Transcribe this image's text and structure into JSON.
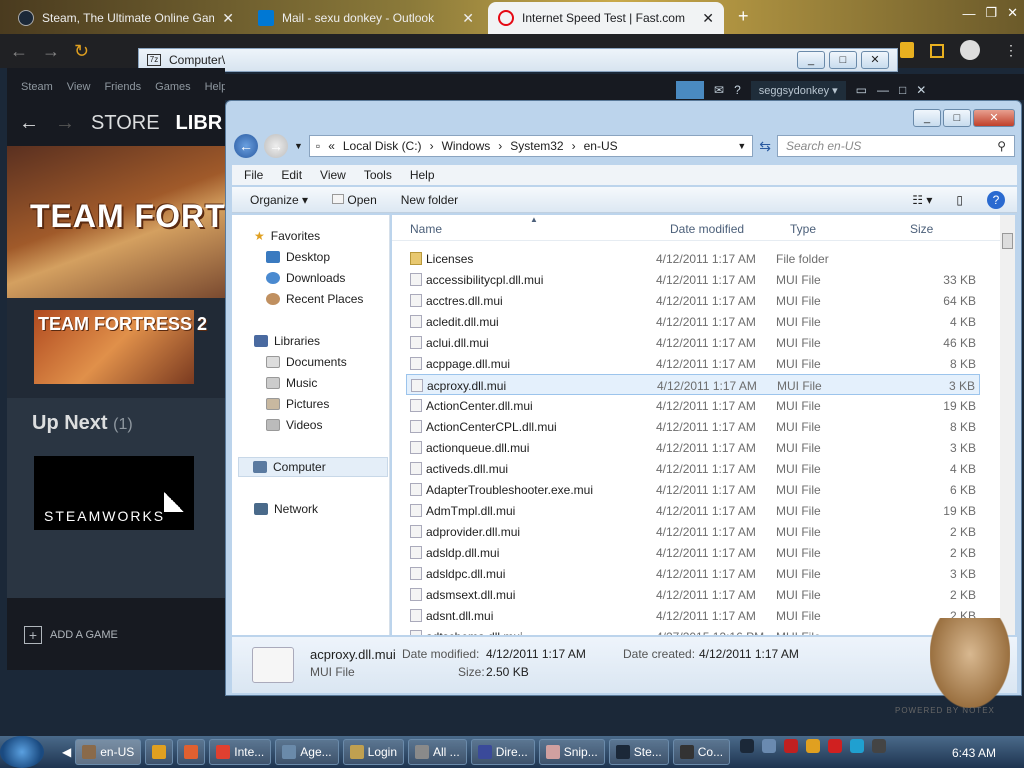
{
  "browser": {
    "tabs": [
      {
        "label": "Steam, The Ultimate Online Gam",
        "color": "#1b2838"
      },
      {
        "label": "Mail - sexu donkey - Outlook",
        "color": "#0078d4"
      },
      {
        "label": "Internet Speed Test | Fast.com",
        "color": "#e50914"
      }
    ],
    "new_tab": "+",
    "close_glyph": "✕"
  },
  "steam": {
    "menu": [
      "Steam",
      "View",
      "Friends",
      "Games",
      "Help"
    ],
    "nav": {
      "back": "←",
      "forward": "→",
      "store": "STORE",
      "library": "LIBR"
    },
    "banner_title": "TEAM FORTRESS",
    "tf2_title": "TEAM FORTRESS 2",
    "upnext": {
      "label": "Up Next",
      "count": "(1)"
    },
    "steamworks": "STEAMWORKS",
    "add_game": "ADD A GAME",
    "username": "seggsydonkey",
    "help": "?"
  },
  "explorer": {
    "outer_title": "Computer\\",
    "breadcrumb": [
      "Local Disk (C:)",
      "Windows",
      "System32",
      "en-US"
    ],
    "search_placeholder": "Search en-US",
    "menu": [
      "File",
      "Edit",
      "View",
      "Tools",
      "Help"
    ],
    "toolbar": {
      "organize": "Organize",
      "open": "Open",
      "new_folder": "New folder"
    },
    "nav": {
      "favorites": "Favorites",
      "desktop": "Desktop",
      "downloads": "Downloads",
      "recent": "Recent Places",
      "libraries": "Libraries",
      "documents": "Documents",
      "music": "Music",
      "pictures": "Pictures",
      "videos": "Videos",
      "computer": "Computer",
      "network": "Network"
    },
    "columns": {
      "name": "Name",
      "date": "Date modified",
      "type": "Type",
      "size": "Size"
    },
    "files": [
      {
        "name": "Licenses",
        "date": "4/12/2011 1:17 AM",
        "type": "File folder",
        "size": "",
        "folder": true
      },
      {
        "name": "accessibilitycpl.dll.mui",
        "date": "4/12/2011 1:17 AM",
        "type": "MUI File",
        "size": "33 KB"
      },
      {
        "name": "acctres.dll.mui",
        "date": "4/12/2011 1:17 AM",
        "type": "MUI File",
        "size": "64 KB"
      },
      {
        "name": "acledit.dll.mui",
        "date": "4/12/2011 1:17 AM",
        "type": "MUI File",
        "size": "4 KB"
      },
      {
        "name": "aclui.dll.mui",
        "date": "4/12/2011 1:17 AM",
        "type": "MUI File",
        "size": "46 KB"
      },
      {
        "name": "acppage.dll.mui",
        "date": "4/12/2011 1:17 AM",
        "type": "MUI File",
        "size": "8 KB"
      },
      {
        "name": "acproxy.dll.mui",
        "date": "4/12/2011 1:17 AM",
        "type": "MUI File",
        "size": "3 KB",
        "selected": true
      },
      {
        "name": "ActionCenter.dll.mui",
        "date": "4/12/2011 1:17 AM",
        "type": "MUI File",
        "size": "19 KB"
      },
      {
        "name": "ActionCenterCPL.dll.mui",
        "date": "4/12/2011 1:17 AM",
        "type": "MUI File",
        "size": "8 KB"
      },
      {
        "name": "actionqueue.dll.mui",
        "date": "4/12/2011 1:17 AM",
        "type": "MUI File",
        "size": "3 KB"
      },
      {
        "name": "activeds.dll.mui",
        "date": "4/12/2011 1:17 AM",
        "type": "MUI File",
        "size": "4 KB"
      },
      {
        "name": "AdapterTroubleshooter.exe.mui",
        "date": "4/12/2011 1:17 AM",
        "type": "MUI File",
        "size": "6 KB"
      },
      {
        "name": "AdmTmpl.dll.mui",
        "date": "4/12/2011 1:17 AM",
        "type": "MUI File",
        "size": "19 KB"
      },
      {
        "name": "adprovider.dll.mui",
        "date": "4/12/2011 1:17 AM",
        "type": "MUI File",
        "size": "2 KB"
      },
      {
        "name": "adsldp.dll.mui",
        "date": "4/12/2011 1:17 AM",
        "type": "MUI File",
        "size": "2 KB"
      },
      {
        "name": "adsldpc.dll.mui",
        "date": "4/12/2011 1:17 AM",
        "type": "MUI File",
        "size": "3 KB"
      },
      {
        "name": "adsmsext.dll.mui",
        "date": "4/12/2011 1:17 AM",
        "type": "MUI File",
        "size": "2 KB"
      },
      {
        "name": "adsnt.dll.mui",
        "date": "4/12/2011 1:17 AM",
        "type": "MUI File",
        "size": "2 KB"
      },
      {
        "name": "adtschema.dll.mui",
        "date": "4/27/2015 12:16 PM",
        "type": "MUI File",
        "size": "6 KB"
      }
    ],
    "details": {
      "name": "acproxy.dll.mui",
      "type": "MUI File",
      "date_modified_label": "Date modified:",
      "date_modified": "4/12/2011 1:17 AM",
      "size_label": "Size:",
      "size": "2.50 KB",
      "date_created_label": "Date created:",
      "date_created": "4/12/2011 1:17 AM"
    }
  },
  "taskbar": {
    "items": [
      "en-US",
      "",
      "",
      "Inte...",
      "Age...",
      "Login",
      "All ...",
      "Dire...",
      "Snip...",
      "Ste...",
      "Co..."
    ],
    "clock": "6:43 AM"
  },
  "watermark": "POWERED BY NOTEX"
}
